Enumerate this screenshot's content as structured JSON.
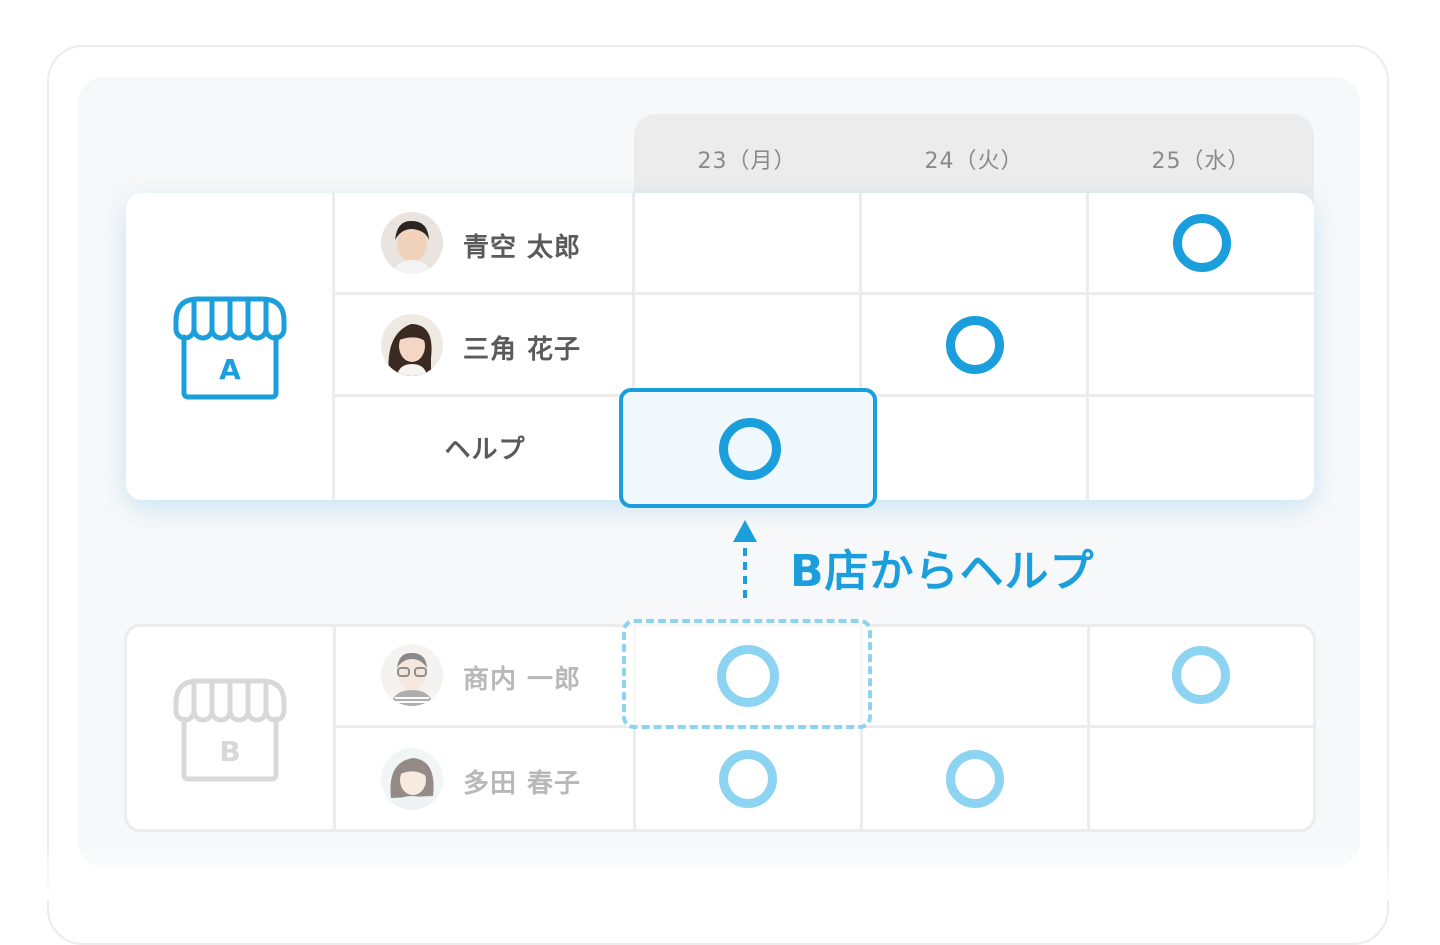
{
  "dates": [
    "23（月）",
    "24（火）",
    "25（水）"
  ],
  "store_a": {
    "icon_letter": "A",
    "staff": [
      {
        "name": "青空 太郎",
        "shifts": [
          false,
          false,
          true
        ]
      },
      {
        "name": "三角 花子",
        "shifts": [
          false,
          true,
          false
        ]
      }
    ],
    "help_row": {
      "label": "ヘルプ",
      "shifts": [
        true,
        false,
        false
      ]
    }
  },
  "store_b": {
    "icon_letter": "B",
    "staff": [
      {
        "name": "商内 一郎",
        "shifts": [
          true,
          false,
          true
        ]
      },
      {
        "name": "多田 春子",
        "shifts": [
          true,
          true,
          false
        ]
      }
    ]
  },
  "callout": {
    "text": "B店からヘルプ"
  },
  "colors": {
    "accent": "#1a9fdc",
    "accent_light": "#8dd3f2",
    "grid": "#ececec",
    "text": "#5a5a5a",
    "text_faded": "#b8b8b8"
  }
}
